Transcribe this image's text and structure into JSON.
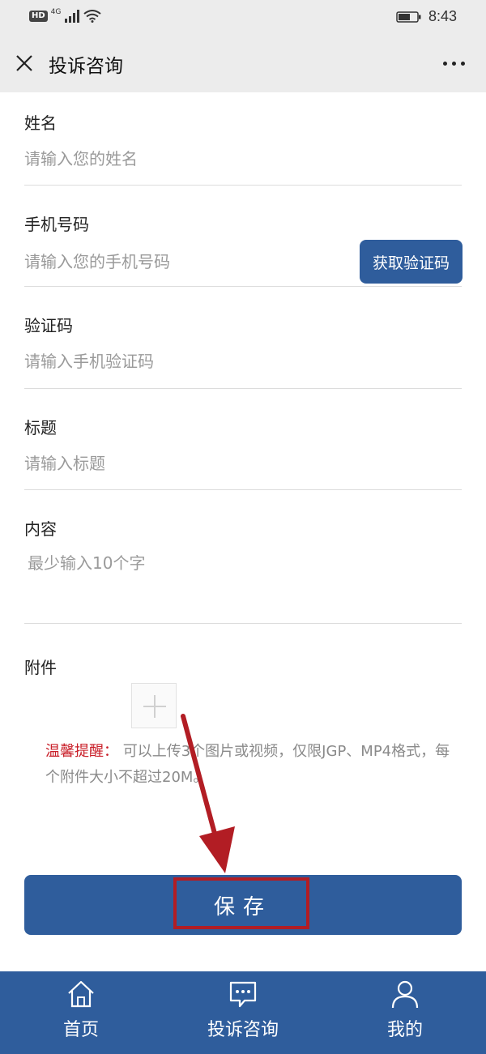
{
  "status_bar": {
    "hd": "HD",
    "network": "4G",
    "time": "8:43"
  },
  "header": {
    "title": "投诉咨询"
  },
  "form": {
    "name": {
      "label": "姓名",
      "placeholder": "请输入您的姓名"
    },
    "phone": {
      "label": "手机号码",
      "placeholder": "请输入您的手机号码",
      "code_button": "获取验证码"
    },
    "code": {
      "label": "验证码",
      "placeholder": "请输入手机验证码"
    },
    "title": {
      "label": "标题",
      "placeholder": "请输入标题"
    },
    "content": {
      "label": "内容",
      "placeholder": "最少输入10个字"
    },
    "attachment": {
      "label": "附件"
    },
    "tip": {
      "prefix": "温馨提醒：",
      "text": "可以上传3个图片或视频，仅限JGP、MP4格式，每个附件大小不超过20M。"
    },
    "save_label": "保存"
  },
  "bottom_nav": [
    {
      "label": "首页",
      "icon": "home-icon"
    },
    {
      "label": "投诉咨询",
      "icon": "chat-icon"
    },
    {
      "label": "我的",
      "icon": "user-icon"
    }
  ],
  "colors": {
    "primary": "#2f5d9c",
    "highlight": "#b21d24",
    "tip_red": "#c9202a"
  }
}
